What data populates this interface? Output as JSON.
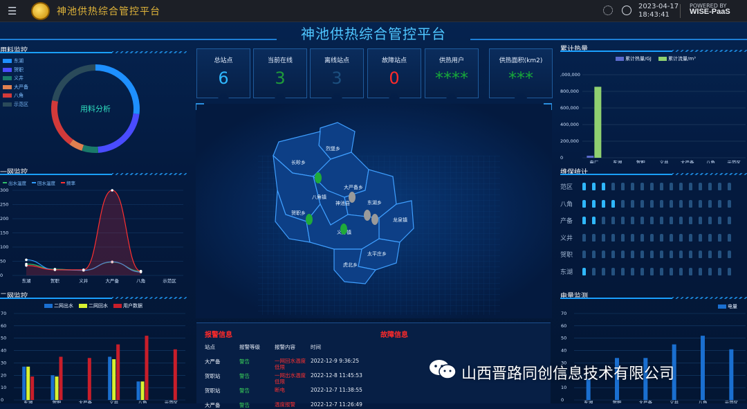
{
  "app": {
    "title": "神池供热综合管控平台",
    "date": "2023-04-17",
    "time": "18:43:41",
    "powered_by": "POWERED BY",
    "powered_brand": "WISE-PaaS"
  },
  "dashboard_title": "神池供热综合管控平台",
  "panels": {
    "material": {
      "title": "用料监控",
      "center_label": "用料分析"
    },
    "primary": {
      "title": "一网监控"
    },
    "secondary": {
      "title": "二网监控"
    },
    "heat": {
      "title": "累计热量"
    },
    "maintenance": {
      "title": "维保统计"
    },
    "power": {
      "title": "电量监测"
    }
  },
  "stats": [
    {
      "label": "总站点",
      "value": "6",
      "color": "#2fb8ff"
    },
    {
      "label": "当前在线",
      "value": "3",
      "color": "#1f9c3a"
    },
    {
      "label": "离线站点",
      "value": "3",
      "color": "#1c4f7f"
    },
    {
      "label": "故障站点",
      "value": "0",
      "color": "#ff2a2a"
    },
    {
      "label": "供热用户",
      "value": "****",
      "color": "#17a83a"
    },
    {
      "label": "供热面积(km2)",
      "value": "***",
      "color": "#17a83a"
    }
  ],
  "map": {
    "regions": [
      "烈堡乡",
      "长畛乡",
      "大严备乡",
      "八角镇",
      "神池县",
      "东湖乡",
      "贺职乡",
      "龙泉镇",
      "义井镇",
      "太平庄乡",
      "虎北乡"
    ]
  },
  "alarm": {
    "title_alarm": "报警信息",
    "title_fault": "故障信息",
    "headers": [
      "站点",
      "报警等级",
      "报警内容",
      "时间"
    ],
    "rows": [
      {
        "site": "大严备",
        "level": "警告",
        "content": "一网回水温度低限",
        "time": "2022-12-9 9:36:25"
      },
      {
        "site": "贺职站",
        "level": "警告",
        "content": "一网出水温度低限",
        "time": "2022-12-8 11:45:53"
      },
      {
        "site": "贺职站",
        "level": "警告",
        "content": "断电",
        "time": "2022-12-7 11:38:55"
      },
      {
        "site": "大严备",
        "level": "警告",
        "content": "温度报警",
        "time": "2022-12-7 11:26:49"
      }
    ]
  },
  "maintenance_rows": [
    {
      "label": "东湖",
      "filled": 1,
      "color": "#2fb8ff"
    },
    {
      "label": "贺职",
      "filled": 0,
      "color": "#ff4a4a"
    },
    {
      "label": "义井",
      "filled": 0,
      "color": "#2fb8ff"
    },
    {
      "label": "产备",
      "filled": 2,
      "color": "#2fb8ff"
    },
    {
      "label": "八角",
      "filled": 4,
      "color": "#2fb8ff"
    },
    {
      "label": "范区",
      "filled": 3,
      "color": "#2fb8ff"
    }
  ],
  "watermark": "山西晋路同创信息技术有限公司",
  "chart_data": [
    {
      "type": "pie",
      "title": "用料监控",
      "categories": [
        "东湖",
        "贺职",
        "义井",
        "大严备",
        "八角",
        "示范区"
      ],
      "values": [
        27,
        22,
        6,
        5,
        18,
        22
      ],
      "colors": [
        "#1e90ff",
        "#4a4cff",
        "#1a7a6a",
        "#e08050",
        "#d23a3a",
        "#2a4a5a"
      ]
    },
    {
      "type": "line",
      "title": "一网监控",
      "categories": [
        "东湖",
        "贺职",
        "义井",
        "大严备",
        "八角",
        "示范区"
      ],
      "ylim": [
        0,
        300
      ],
      "yticks": [
        0,
        50,
        100,
        150,
        200,
        250,
        300
      ],
      "series": [
        {
          "name": "出水温度",
          "values": [
            40,
            22,
            18,
            47,
            15,
            null
          ],
          "color": "#2fbf6a"
        },
        {
          "name": "回水温度",
          "values": [
            55,
            20,
            18,
            48,
            12,
            null
          ],
          "color": "#2f9cff"
        },
        {
          "name": "频率",
          "values": [
            35,
            20,
            20,
            300,
            15,
            null
          ],
          "color": "#ff3030"
        }
      ]
    },
    {
      "type": "bar",
      "title": "二网监控",
      "categories": [
        "东湖",
        "贺职",
        "大严备",
        "义井",
        "八角",
        "示范区"
      ],
      "ylim": [
        0,
        70
      ],
      "yticks": [
        0,
        10,
        20,
        30,
        40,
        50,
        60,
        70
      ],
      "series": [
        {
          "name": "二网出水",
          "values": [
            27,
            20,
            null,
            35,
            15,
            null
          ],
          "color": "#1a6fd0"
        },
        {
          "name": "二网回水",
          "values": [
            27,
            19,
            null,
            33,
            15,
            null
          ],
          "color": "#d8f030"
        },
        {
          "name": "用户数据",
          "values": [
            19,
            35,
            34,
            45,
            52,
            41
          ],
          "color": "#c81e2a"
        }
      ]
    },
    {
      "type": "bar",
      "title": "累计热量",
      "categories": [
        "电厂",
        "东湖",
        "贺职",
        "义井",
        "大严备",
        "八角",
        "示范区"
      ],
      "ylim": [
        0,
        1000000
      ],
      "ytick_labels": [
        "0",
        "200,000",
        "400,000",
        "600,000",
        "800,000",
        ",000,000"
      ],
      "series": [
        {
          "name": "累计热量/GJ",
          "values": [
            25000,
            0,
            0,
            0,
            0,
            0,
            0
          ],
          "color": "#5a6acd"
        },
        {
          "name": "累计流量/m³",
          "values": [
            855000,
            0,
            0,
            0,
            0,
            0,
            0
          ],
          "color": "#8fd070"
        }
      ]
    },
    {
      "type": "bar",
      "title": "电量监测",
      "categories": [
        "东湖",
        "贺职",
        "大严备",
        "义井",
        "八角",
        "示范区"
      ],
      "ylim": [
        0,
        70
      ],
      "yticks": [
        0,
        10,
        20,
        30,
        40,
        50,
        60,
        70
      ],
      "series": [
        {
          "name": "电量",
          "values": [
            17,
            34,
            34,
            45,
            52,
            41
          ],
          "color": "#1a6fd0"
        }
      ]
    }
  ]
}
